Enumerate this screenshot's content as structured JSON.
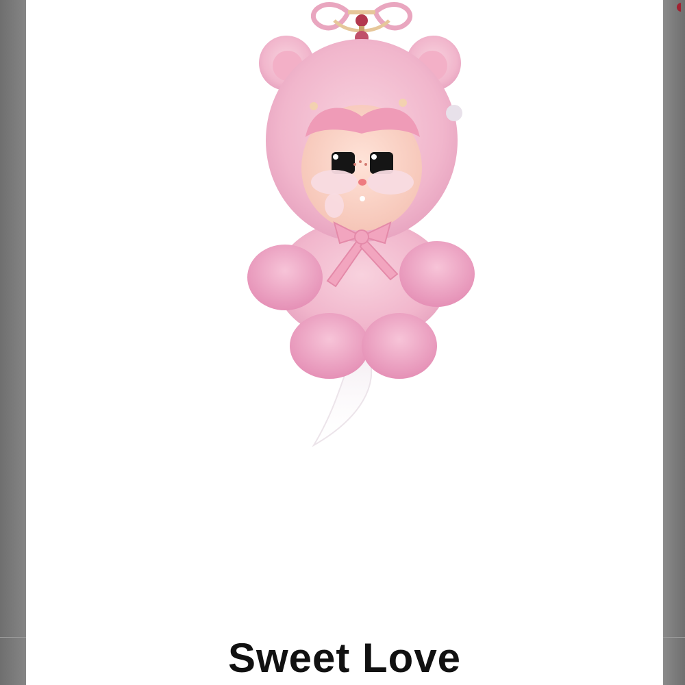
{
  "product": {
    "title": "Sweet Love",
    "image_icon": "pink-plush-doll-pendant-icon"
  },
  "colors": {
    "background_overlay": "#808080",
    "card": "#ffffff",
    "plush_pink": "#f2b8cf",
    "accent_red": "#a12030"
  }
}
